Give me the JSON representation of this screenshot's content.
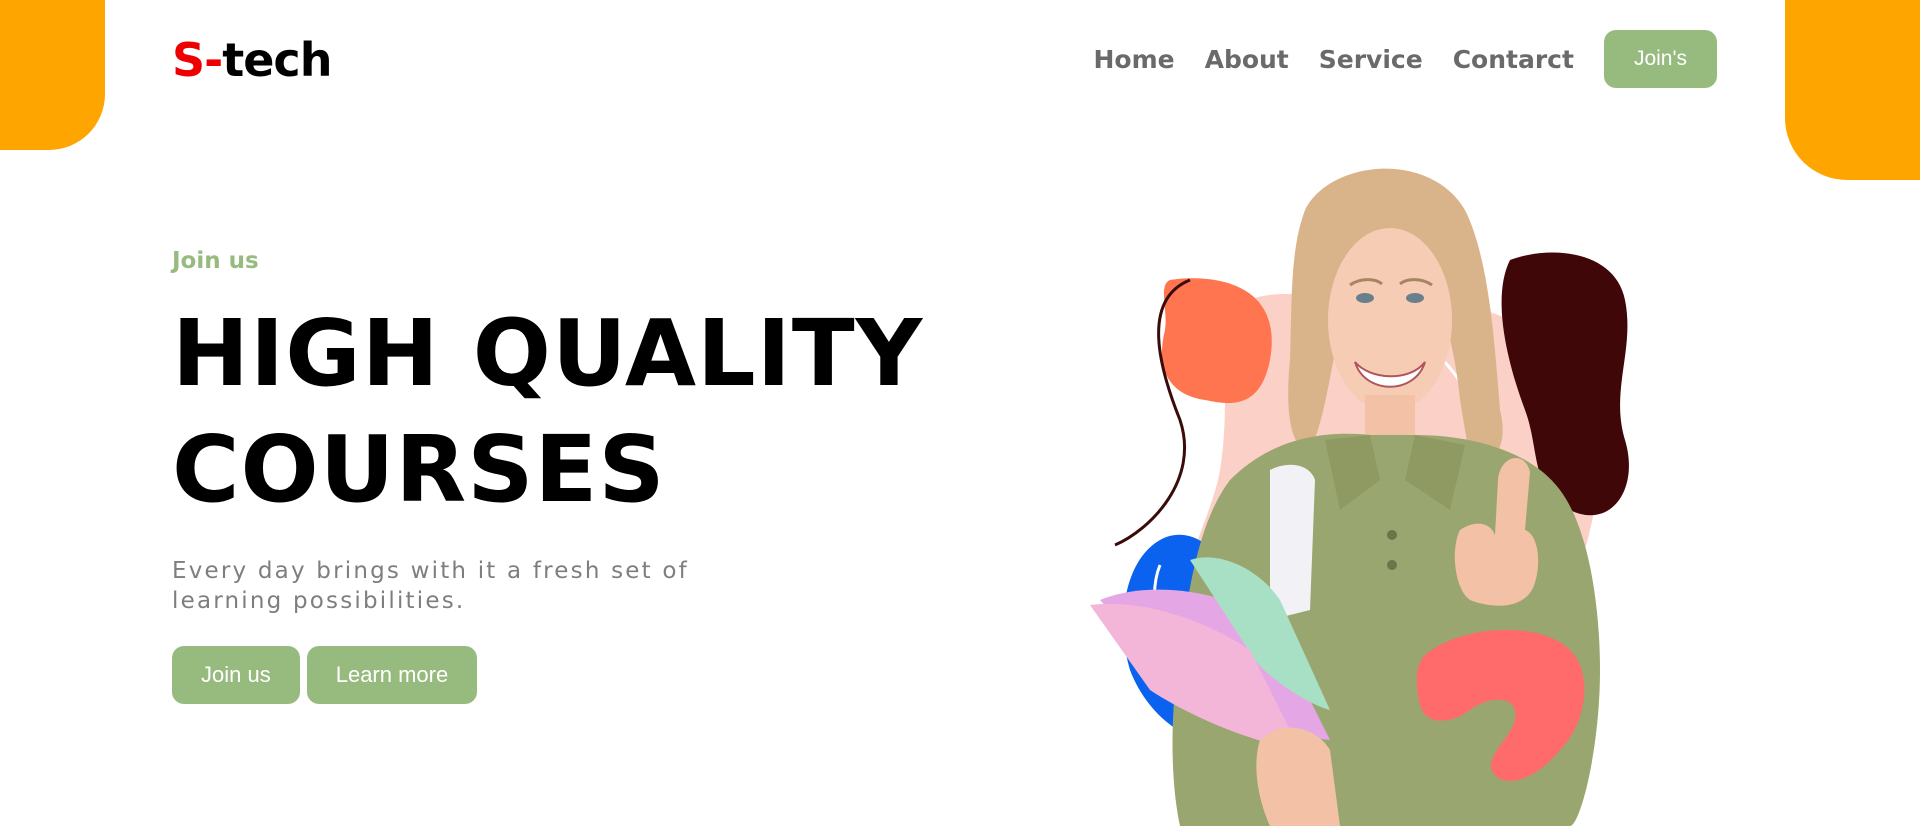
{
  "colors": {
    "accent_orange": "#ffa500",
    "green": "#97bb7f",
    "logo_red": "#ee0000",
    "logo_dark": "#000000",
    "blob_coral": "#ff7550",
    "blob_pink": "#fbd0c6",
    "blob_maroon": "#400709",
    "blob_blue": "#0a62ef",
    "blob_salmon": "#ff6b6b"
  },
  "logo": {
    "prefix": "S-",
    "suffix": "tech"
  },
  "nav": {
    "items": [
      {
        "label": "Home"
      },
      {
        "label": "About"
      },
      {
        "label": "Service"
      },
      {
        "label": "Contarct"
      }
    ],
    "cta_label": "Join's"
  },
  "hero": {
    "eyebrow": "Join us",
    "headline_line1": "HIGH QUALITY",
    "headline_line2": "COURSES",
    "tagline": "Every day brings with it a fresh set of learning possibilities.",
    "primary_button": "Join us",
    "secondary_button": "Learn more"
  },
  "illustration": {
    "subject": "smiling student holding notebooks giving a thumbs up"
  }
}
